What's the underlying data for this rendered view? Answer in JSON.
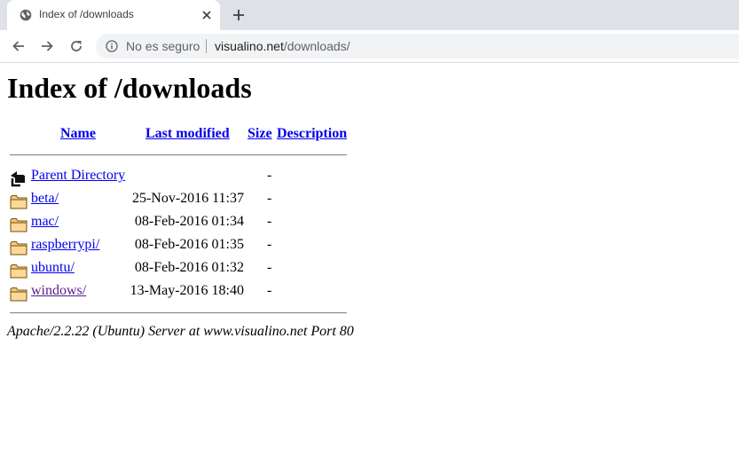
{
  "browser": {
    "tab_title": "Index of /downloads",
    "security_label": "No es seguro",
    "url_host": "visualino.net",
    "url_path": "/downloads/"
  },
  "page": {
    "heading": "Index of /downloads",
    "columns": {
      "name": "Name",
      "last_modified": "Last modified",
      "size": "Size",
      "description": "Description"
    },
    "parent": {
      "label": "Parent Directory",
      "size": "-"
    },
    "entries": [
      {
        "name": "beta/",
        "modified": "25-Nov-2016 11:37",
        "size": "-",
        "visited": false
      },
      {
        "name": "mac/",
        "modified": "08-Feb-2016 01:34",
        "size": "-",
        "visited": false
      },
      {
        "name": "raspberrypi/",
        "modified": "08-Feb-2016 01:35",
        "size": "-",
        "visited": false
      },
      {
        "name": "ubuntu/",
        "modified": "08-Feb-2016 01:32",
        "size": "-",
        "visited": false
      },
      {
        "name": "windows/",
        "modified": "13-May-2016 18:40",
        "size": "-",
        "visited": true
      }
    ],
    "footer": "Apache/2.2.22 (Ubuntu) Server at www.visualino.net Port 80"
  },
  "colors": {
    "link": "#0000ee",
    "visited_link": "#551a8b",
    "tabbar_bg": "#dee1e6",
    "omnibox_bg": "#f1f3f4"
  },
  "icons": {
    "tab_favicon": "globe-icon",
    "tab_close": "close-icon",
    "new_tab": "plus-icon",
    "back": "back-arrow-icon",
    "forward": "forward-arrow-icon",
    "reload": "reload-icon",
    "site_info": "info-icon",
    "parent": "back-folder-icon",
    "entry": "folder-icon"
  }
}
